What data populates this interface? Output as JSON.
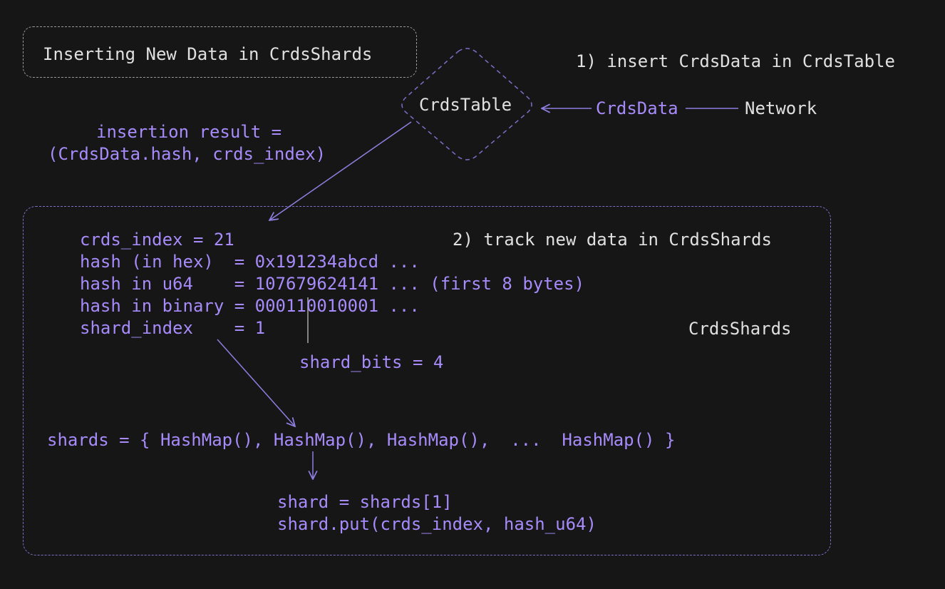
{
  "title": "Inserting New Data in CrdsShards",
  "step1": "1) insert CrdsData in CrdsTable",
  "step2": "2) track new data in CrdsShards",
  "nodes": {
    "crds_table": "CrdsTable",
    "crds_data": "CrdsData",
    "network": "Network",
    "crds_shards": "CrdsShards"
  },
  "insertion_result": {
    "line1": "insertion result =",
    "line2": "(CrdsData.hash, crds_index)"
  },
  "details": [
    "crds_index = 21",
    "hash (in hex)  = 0x191234abcd ...",
    "hash in u64    = 107679624141 ... (first 8 bytes)",
    "hash in binary = 000110010001 ...",
    "shard_index    = 1"
  ],
  "shard_bits": "shard_bits = 4",
  "shards_line": "shards = { HashMap(), HashMap(), HashMap(),  ...  HashMap() }",
  "shard_code": [
    "shard = shards[1]",
    "shard.put(crds_index, hash_u64)"
  ],
  "colors": {
    "background": "#161616",
    "accent": "#a78bfa",
    "text": "#e0e0e0",
    "dashed_border": "#9a9a9a"
  }
}
